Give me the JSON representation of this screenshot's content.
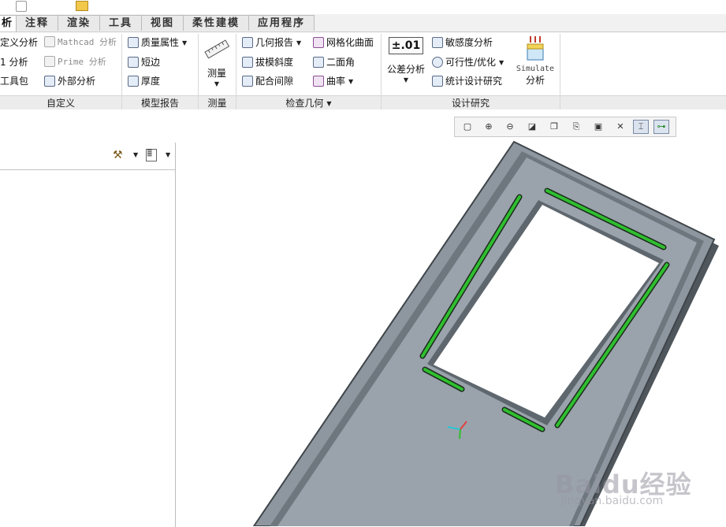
{
  "tabs": [
    {
      "label": "析",
      "active": true
    },
    {
      "label": "注释"
    },
    {
      "label": "渲染"
    },
    {
      "label": "工具"
    },
    {
      "label": "视图"
    },
    {
      "label": "柔性建模"
    },
    {
      "label": "应用程序"
    }
  ],
  "groups": {
    "custom": {
      "label": "自定义",
      "items": [
        "定义分析",
        "1 分析",
        "工具包"
      ]
    },
    "model_report": {
      "label": "模型报告",
      "items": [
        "Mathcad 分析",
        "Prime 分析",
        "外部分析",
        "质量属性",
        "短边",
        "厚度"
      ]
    },
    "measure": {
      "label": "测量",
      "button": "测量"
    },
    "inspect_geometry": {
      "label": "检查几何",
      "items": [
        "几何报告",
        "拔模斜度",
        "配合间隙",
        "网格化曲面",
        "二面角",
        "曲率"
      ]
    },
    "design_study": {
      "label": "设计研究",
      "tolerance_icon": "±.01",
      "tolerance_label": "公差分析",
      "items": [
        "敏感度分析",
        "可行性/优化",
        "统计设计研究"
      ],
      "simulate_line1": "Simulate",
      "simulate_line2": "分析"
    }
  },
  "watermark": {
    "brand": "Baidu经验",
    "url": "jingyan.baidu.com"
  },
  "colors": {
    "model": "#9aa3ac",
    "model_edge": "#4f565c",
    "highlight": "#2fbf2f",
    "ribbon_bg": "#ffffff"
  }
}
